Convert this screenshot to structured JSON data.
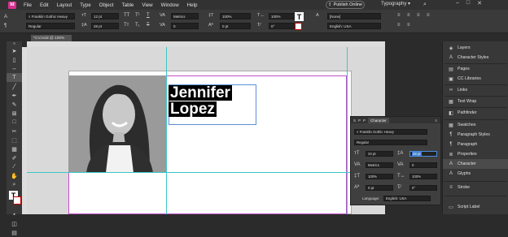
{
  "app": {
    "logo": "Id"
  },
  "menu": [
    "File",
    "Edit",
    "Layout",
    "Type",
    "Object",
    "Table",
    "View",
    "Window",
    "Help"
  ],
  "topbar": {
    "publish_label": "Publish Online",
    "workspace": "Typography"
  },
  "control": {
    "font": "Franklin Gothic Heavy",
    "style": "Regular",
    "size1": "12 pt",
    "size2": "28 pt",
    "kerning": "Metrics",
    "tracking": "0",
    "hscale": "100%",
    "vscale": "100%",
    "baseline": "0 pt",
    "skew": "0°",
    "char_style": "[None]",
    "language": "English: USA"
  },
  "document": {
    "tab_label": "*CV.indd @ 100%"
  },
  "card": {
    "name_line1": "Jennifer",
    "name_line2": "Lopez"
  },
  "character_panel": {
    "tabs": [
      "S",
      "P",
      "P",
      "Character"
    ],
    "font": "Franklin Gothic Heavy",
    "style": "Regular",
    "size": "34 pt",
    "leading": "28 pt",
    "kerning": "Metrics",
    "tracking": "0",
    "vscale": "100%",
    "hscale": "100%",
    "baseline": "0 pt",
    "skew": "0°",
    "language_label": "Language:",
    "language": "English: USA"
  },
  "dock": [
    {
      "label": "Layers",
      "icon": "layers-icon"
    },
    {
      "label": "Character Styles",
      "icon": "char-styles-icon"
    },
    {
      "label": "Pages",
      "icon": "pages-icon"
    },
    {
      "label": "CC Libraries",
      "icon": "cc-libraries-icon"
    },
    {
      "label": "Links",
      "icon": "links-icon"
    },
    {
      "label": "Text Wrap",
      "icon": "text-wrap-icon"
    },
    {
      "label": "Pathfinder",
      "icon": "pathfinder-icon"
    },
    {
      "label": "Swatches",
      "icon": "swatches-icon"
    },
    {
      "label": "Paragraph Styles",
      "icon": "para-styles-icon"
    },
    {
      "label": "Paragraph",
      "icon": "paragraph-icon"
    },
    {
      "label": "Properties",
      "icon": "properties-icon"
    },
    {
      "label": "Character",
      "icon": "character-icon"
    },
    {
      "label": "Glyphs",
      "icon": "glyphs-icon"
    },
    {
      "label": "Stroke",
      "icon": "stroke-icon"
    },
    {
      "label": "Script Label",
      "icon": "script-label-icon"
    }
  ],
  "colors": {
    "accent": "#d62f8f",
    "guide": "#3cc7c7",
    "margin": "#c44ecb",
    "frame": "#5c8fd6"
  }
}
